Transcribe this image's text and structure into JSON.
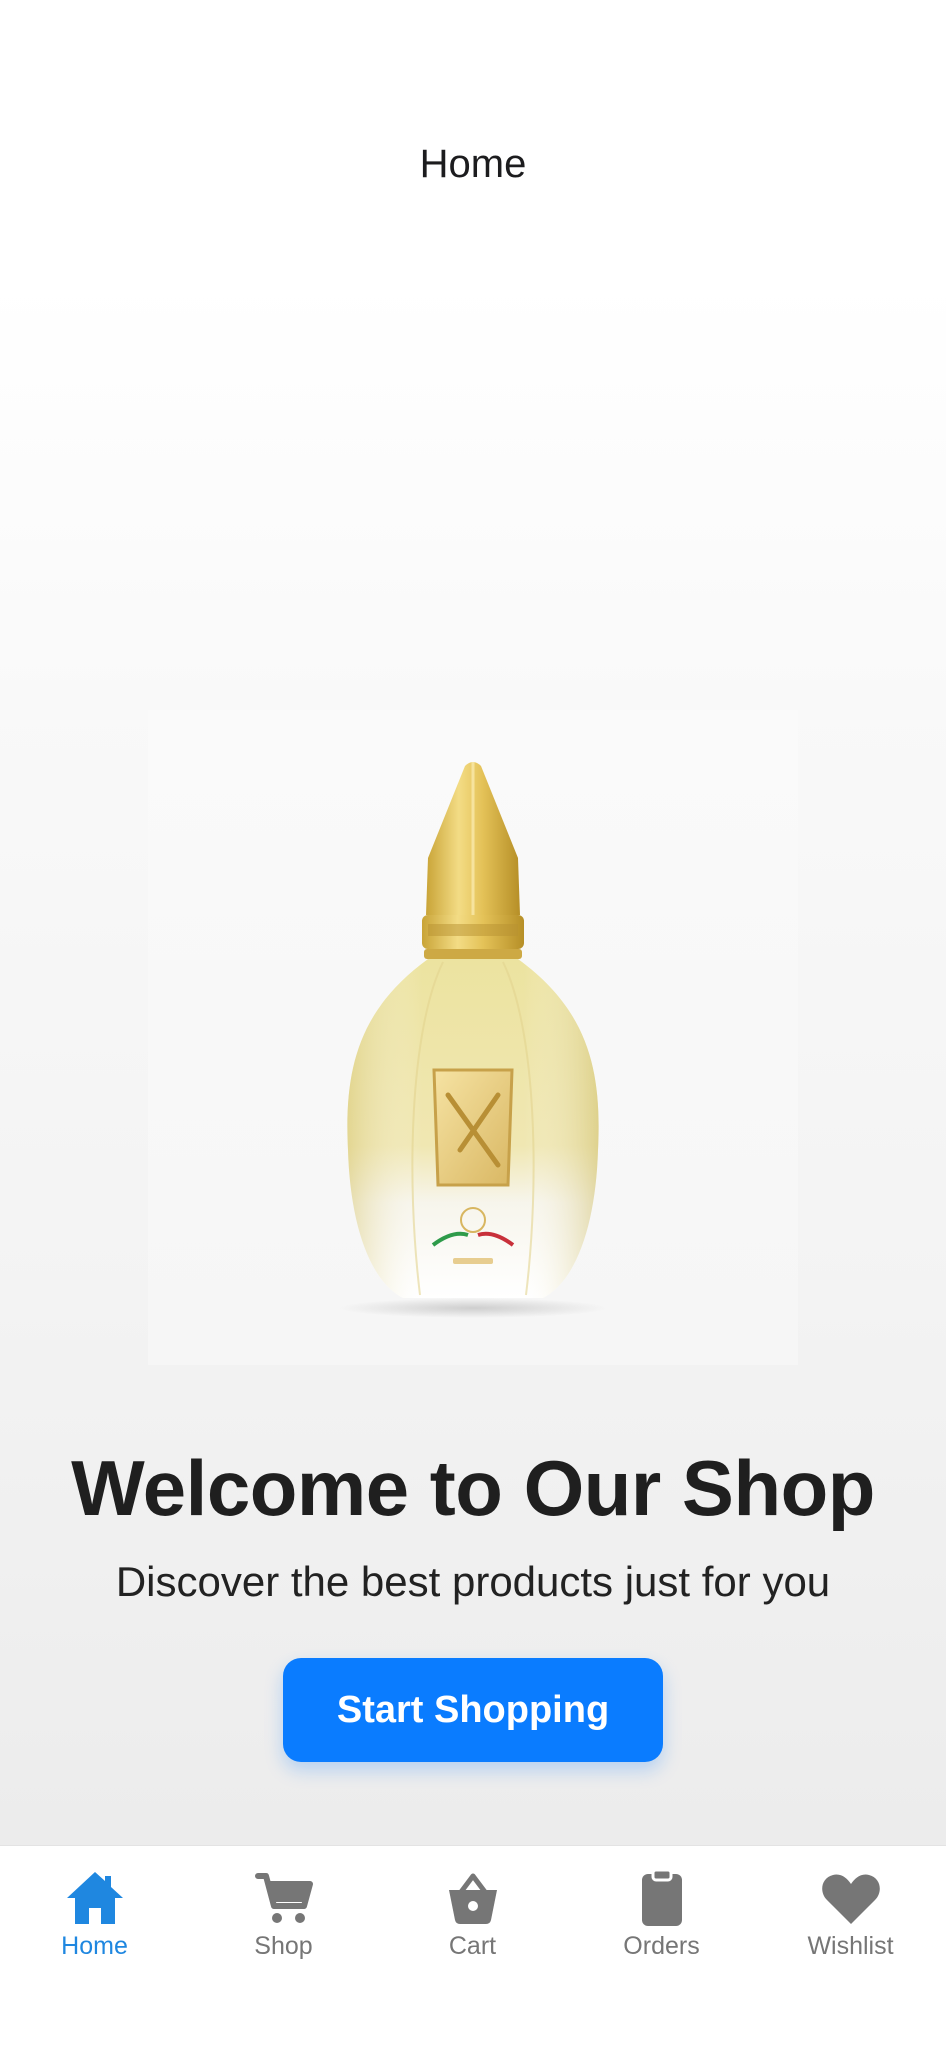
{
  "header": {
    "title": "Home"
  },
  "hero": {
    "image_icon": "perfume-bottle-image",
    "title": "Welcome to Our Shop",
    "subtitle": "Discover the best products just for you",
    "cta_label": "Start Shopping"
  },
  "tabbar": {
    "active_color": "#1f87e0",
    "inactive_color": "#767676",
    "items": [
      {
        "label": "Home",
        "icon": "home-icon",
        "active": true
      },
      {
        "label": "Shop",
        "icon": "cart-icon",
        "active": false
      },
      {
        "label": "Cart",
        "icon": "basket-icon",
        "active": false
      },
      {
        "label": "Orders",
        "icon": "clipboard-icon",
        "active": false
      },
      {
        "label": "Wishlist",
        "icon": "heart-icon",
        "active": false
      }
    ]
  },
  "colors": {
    "primary": "#0a7cff",
    "text_dark": "#1f1f1f"
  }
}
